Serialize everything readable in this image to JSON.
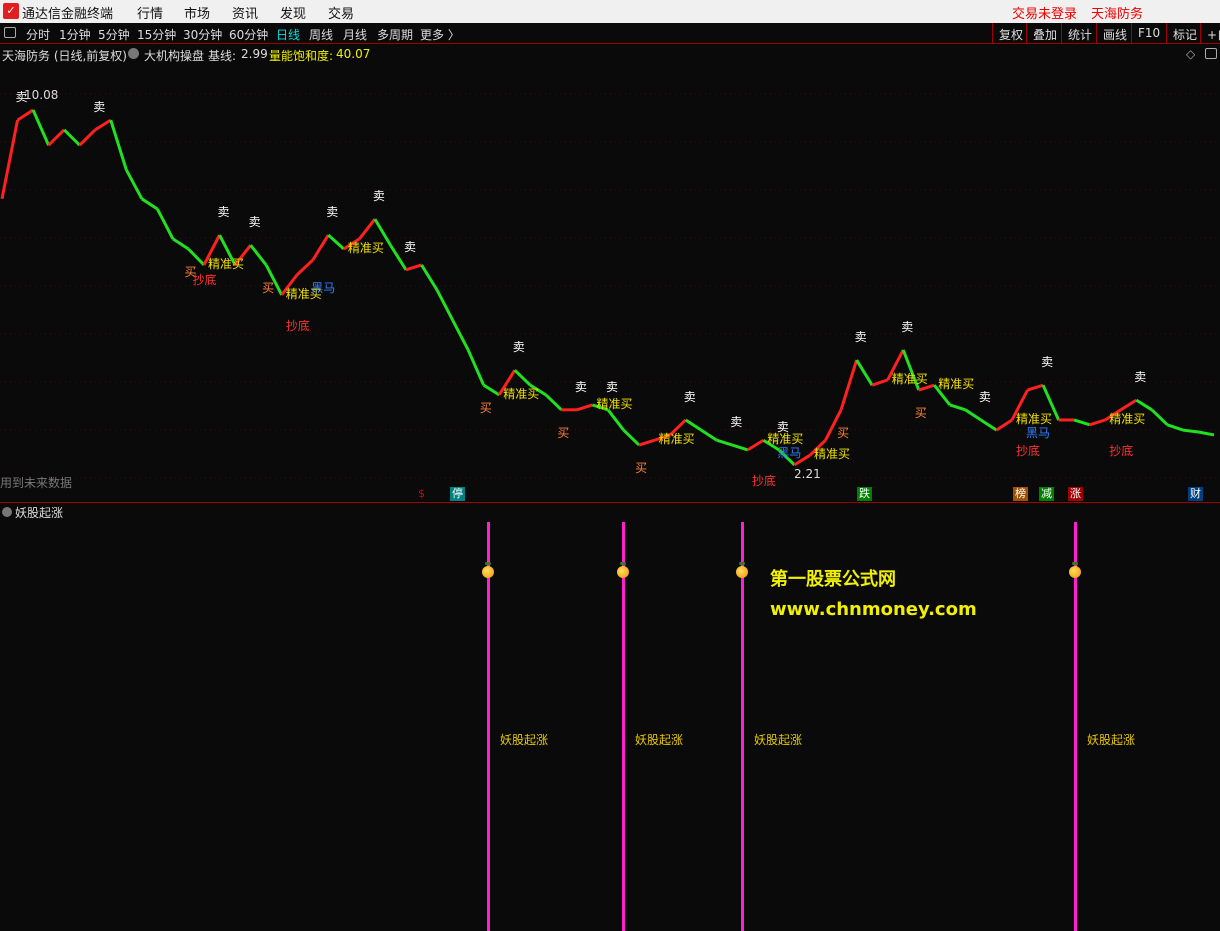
{
  "titlebar": {
    "app_name": "通达信金融终端",
    "menus": [
      "行情",
      "市场",
      "资讯",
      "发现",
      "交易"
    ],
    "login_status": "交易未登录",
    "stock_name": "天海防务"
  },
  "toolbar": {
    "periods": [
      "分时",
      "1分钟",
      "5分钟",
      "15分钟",
      "30分钟",
      "60分钟",
      "日线",
      "周线",
      "月线",
      "多周期",
      "更多 〉"
    ],
    "selected_period": "日线",
    "right_buttons": [
      "复权",
      "叠加",
      "统计",
      "画线",
      "F10",
      "标记",
      "+自"
    ]
  },
  "infobar": {
    "title": "天海防务 (日线,前复权)",
    "indicator": "大机构操盘",
    "baseline_label": "基线:",
    "baseline_value": "2.99",
    "saturation_label": "量能饱和度:",
    "saturation_value": "40.07"
  },
  "chart": {
    "high_label": "10.08",
    "low_label": "2.21",
    "future_data_note": "用到未来数据",
    "prices": [
      7.93,
      9.56,
      9.77,
      9.04,
      9.36,
      9.04,
      9.36,
      9.56,
      8.53,
      7.93,
      7.72,
      7.1,
      6.89,
      6.56,
      7.18,
      6.56,
      6.97,
      6.56,
      5.94,
      6.36,
      6.66,
      7.18,
      6.89,
      7.1,
      7.51,
      6.97,
      6.46,
      6.56,
      6.04,
      5.42,
      4.8,
      4.07,
      3.87,
      4.38,
      4.07,
      3.87,
      3.56,
      3.56,
      3.66,
      3.56,
      3.14,
      2.83,
      2.93,
      3.04,
      3.35,
      3.14,
      2.93,
      2.83,
      2.73,
      2.93,
      2.73,
      2.42,
      2.62,
      2.93,
      3.56,
      4.59,
      4.07,
      4.18,
      4.8,
      3.97,
      4.07,
      3.66,
      3.56,
      3.35,
      3.14,
      3.35,
      3.97,
      4.07,
      3.35,
      3.35,
      3.25,
      3.35,
      3.56,
      3.76,
      3.56,
      3.25,
      3.14,
      3.1,
      3.04
    ],
    "signals": [
      {
        "i": 1,
        "text": "卖",
        "type": "sell"
      },
      {
        "i": 6,
        "text": "卖",
        "type": "sell"
      },
      {
        "i": 14,
        "text": "卖",
        "type": "sell"
      },
      {
        "i": 16,
        "text": "卖",
        "type": "sell"
      },
      {
        "i": 21,
        "text": "卖",
        "type": "sell"
      },
      {
        "i": 24,
        "text": "卖",
        "type": "sell"
      },
      {
        "i": 26,
        "text": "卖",
        "type": "sell"
      },
      {
        "i": 33,
        "text": "卖",
        "type": "sell"
      },
      {
        "i": 37,
        "text": "卖",
        "type": "sell"
      },
      {
        "i": 39,
        "text": "卖",
        "type": "sell"
      },
      {
        "i": 44,
        "text": "卖",
        "type": "sell"
      },
      {
        "i": 47,
        "text": "卖",
        "type": "sell"
      },
      {
        "i": 50,
        "text": "卖",
        "type": "sell"
      },
      {
        "i": 55,
        "text": "卖",
        "type": "sell"
      },
      {
        "i": 58,
        "text": "卖",
        "type": "sell"
      },
      {
        "i": 63,
        "text": "卖",
        "type": "sell"
      },
      {
        "i": 67,
        "text": "卖",
        "type": "sell"
      },
      {
        "i": 73,
        "text": "卖",
        "type": "sell"
      },
      {
        "i": 13,
        "text": "精准买",
        "type": "precise"
      },
      {
        "i": 18,
        "text": "精准买",
        "type": "precise"
      },
      {
        "i": 22,
        "text": "精准买",
        "type": "precise"
      },
      {
        "i": 32,
        "text": "精准买",
        "type": "precise"
      },
      {
        "i": 38,
        "text": "精准买",
        "type": "precise"
      },
      {
        "i": 42,
        "text": "精准买",
        "type": "precise"
      },
      {
        "i": 49,
        "text": "精准买",
        "type": "precise"
      },
      {
        "i": 52,
        "text": "精准买",
        "type": "precise"
      },
      {
        "i": 57,
        "text": "精准买",
        "type": "precise"
      },
      {
        "i": 60,
        "text": "精准买",
        "type": "precise"
      },
      {
        "i": 65,
        "text": "精准买",
        "type": "precise"
      },
      {
        "i": 71,
        "text": "精准买",
        "type": "precise"
      },
      {
        "i": 12,
        "text": "买",
        "type": "buy"
      },
      {
        "i": 17,
        "text": "买",
        "type": "buy"
      },
      {
        "i": 31,
        "text": "买",
        "type": "buy"
      },
      {
        "i": 36,
        "text": "买",
        "type": "buy"
      },
      {
        "i": 41,
        "text": "买",
        "type": "buy"
      },
      {
        "i": 54,
        "text": "买",
        "type": "buy"
      },
      {
        "i": 59,
        "text": "买",
        "type": "buy"
      },
      {
        "i": 12,
        "text": "抄底",
        "type": "bottom"
      },
      {
        "i": 18,
        "text": "抄底",
        "type": "bottom"
      },
      {
        "i": 48,
        "text": "抄底",
        "type": "bottom"
      },
      {
        "i": 65,
        "text": "抄底",
        "type": "bottom"
      },
      {
        "i": 71,
        "text": "抄底",
        "type": "bottom"
      },
      {
        "i": 19,
        "text": "黑马",
        "type": "horse"
      },
      {
        "i": 49,
        "text": "黑马",
        "type": "horse"
      },
      {
        "i": 65,
        "text": "黑马",
        "type": "horse"
      }
    ],
    "markers": [
      {
        "text": "$",
        "color": "#e00000",
        "bg": "transparent"
      },
      {
        "text": "停",
        "color": "#fff",
        "bg": "#008080"
      },
      {
        "text": "跌",
        "color": "#fff",
        "bg": "#008000"
      },
      {
        "text": "榜",
        "color": "#fff",
        "bg": "#a05000"
      },
      {
        "text": "减",
        "color": "#fff",
        "bg": "#008000"
      },
      {
        "text": "涨",
        "color": "#fff",
        "bg": "#a00000"
      },
      {
        "text": "财",
        "color": "#fff",
        "bg": "#004080"
      }
    ]
  },
  "pane2": {
    "title": "妖股起涨",
    "signal_label": "妖股起涨",
    "signals_count": 4
  },
  "watermark": {
    "line1": "第一股票公式网",
    "line2": "www.chnmoney.com"
  },
  "colors": {
    "up": "#ff2020",
    "down": "#20e020",
    "signal_line": "#ff20d0"
  }
}
